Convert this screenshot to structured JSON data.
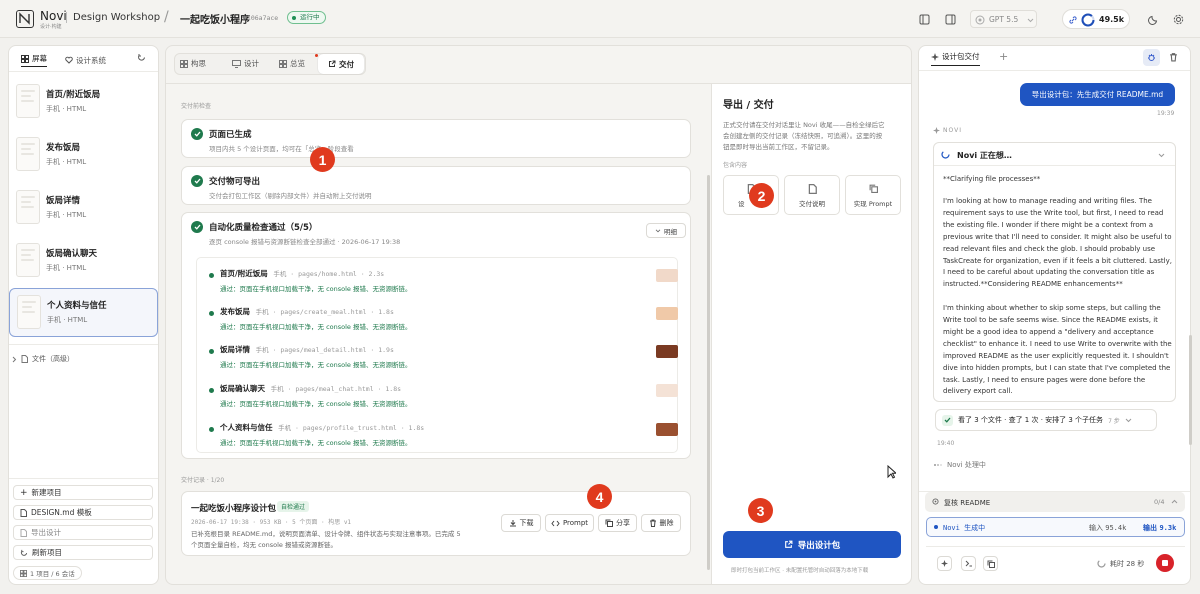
{
  "header": {
    "logo_text": "Novi",
    "logo_sub": "设计·构建",
    "workspace": "Design Workshop",
    "separator": "/",
    "project": "一起吃饭小程序",
    "project_id": "#106a7ace",
    "status": "运行中",
    "model": "GPT 5.5",
    "tokens": "49.5k"
  },
  "sidebar": {
    "tabs": [
      {
        "label": "屏幕"
      },
      {
        "label": "设计系统"
      }
    ],
    "items": [
      {
        "name": "首页/附近饭局",
        "sub": "手机 · HTML"
      },
      {
        "name": "发布饭局",
        "sub": "手机 · HTML"
      },
      {
        "name": "饭局详情",
        "sub": "手机 · HTML"
      },
      {
        "name": "饭局确认聊天",
        "sub": "手机 · HTML"
      },
      {
        "name": "个人资料与信任",
        "sub": "手机 · HTML"
      }
    ],
    "files_label": "文件（高级）",
    "new_project": "新建项目",
    "design_md": "DESIGN.md 模板",
    "export_design": "导出设计",
    "refresh": "刷新项目",
    "footer": "1 项目 / 6 会话"
  },
  "tabs": [
    {
      "label": "构思"
    },
    {
      "label": "设计"
    },
    {
      "label": "总览"
    },
    {
      "label": "交付"
    }
  ],
  "checklist": {
    "title": "交付前检查",
    "items": [
      {
        "title": "页面已生成",
        "desc": "项目内共 5 个设计页面，均可在「总览」阶段查看"
      },
      {
        "title": "交付物可导出",
        "desc": "交付会打包工作区（剔除内部文件）并自动附上交付说明"
      },
      {
        "title": "自动化质量检查通过（5/5）",
        "desc": "逐页 console 报错与资源断链检查全部通过 · 2026-06-17 19:38",
        "toggle": "明细"
      }
    ],
    "pages": [
      {
        "name": "首页/附近饭局",
        "meta": "手机 · pages/home.html · 2.3s",
        "pass": "通过：页面在手机视口加载干净，无 console 报错、无资源断链。",
        "thumb": "#f1d9c9"
      },
      {
        "name": "发布饭局",
        "meta": "手机 · pages/create_meal.html · 1.8s",
        "pass": "通过：页面在手机视口加载干净，无 console 报错、无资源断链。",
        "thumb": "#f0c9a8"
      },
      {
        "name": "饭局详情",
        "meta": "手机 · pages/meal_detail.html · 1.9s",
        "pass": "通过：页面在手机视口加载干净，无 console 报错、无资源断链。",
        "thumb": "#7a3a22"
      },
      {
        "name": "饭局确认聊天",
        "meta": "手机 · pages/meal_chat.html · 1.8s",
        "pass": "通过：页面在手机视口加载干净，无 console 报错、无资源断链。",
        "thumb": "#f4e2d6"
      },
      {
        "name": "个人资料与信任",
        "meta": "手机 · pages/profile_trust.html · 1.8s",
        "pass": "通过：页面在手机视口加载干净，无 console 报错、无资源断链。",
        "thumb": "#9a5030"
      }
    ]
  },
  "records": {
    "title": "交付记录 · 1/20",
    "item": {
      "name": "一起吃饭小程序设计包",
      "badge": "自检通过",
      "meta": "2026-06-17 19:38 · 953 KB · 5 个页面 · 构思 v1",
      "desc1": "已补充根目录 README.md，说明页面清单、设计令牌、组件状态与实现注意事项。已完成 5",
      "desc2": "个页面全量自检，均无 console 报错或资源断链。"
    },
    "buttons": {
      "download": "下载",
      "prompt": "Prompt",
      "share": "分享",
      "delete": "删除"
    }
  },
  "export": {
    "title": "导出 / 交付",
    "desc1": "正式交付请在交付对话里让 Novi 收尾——自检全绿后它",
    "desc2": "会创建左侧的交付记录（冻结快照，可追溯）。这里的按",
    "desc3": "钮是即时导出当前工作区，不留记录。",
    "includes": "包含内容",
    "inc": [
      {
        "label": "设"
      },
      {
        "label": "交付说明"
      },
      {
        "label": "实现 Prompt"
      }
    ],
    "button": "导出设计包",
    "footnote": "即时打包当前工作区 · 未配置托管时自动回落为本地下载"
  },
  "chat": {
    "tab": "设计包交付",
    "user_msg": "导出设计包：先生成交付 README.md",
    "user_time": "19:39",
    "agent": "NOVI",
    "thinking_title": "Novi 正在想…",
    "thinking_head": "**Clarifying file processes**",
    "lines": [
      "I'm looking at how to manage reading and writing files. The",
      "requirement says to use the Write tool, but first, I need to read",
      "the existing file. I wonder if there might be a context from a",
      "previous write that I'll need to consider. It might also be useful to",
      "read relevant files and check the glob. I should probably use",
      "TaskCreate for organization, even if it feels a bit cluttered. Lastly,",
      "I need to be careful about updating the conversation title as",
      "instructed.**Considering README enhancements**",
      "",
      "I'm thinking about whether to skip some steps, but calling the",
      "Write tool to be safe seems wise. Since the README exists, it",
      "might be a good idea to append a \"delivery and acceptance",
      "checklist\" to enhance it. I need to use Write to overwrite with the",
      "improved README as the user explicitly requested it. I shouldn't",
      "dive into hidden prompts, but I can state that I've completed the",
      "task. Lastly, I need to ensure pages were done before the",
      "delivery export call."
    ],
    "steps": "看了 3 个文件 · 查了 1 次 · 安排了 3 个子任务",
    "steps_count": "7 步",
    "time": "19:40",
    "processing": "Novi 处理中",
    "task": "复核 README",
    "task_count": "0/4",
    "gen": "Novi 生成中",
    "input_label": "输入",
    "input_val": "95.4k",
    "output_label": "输出",
    "output_val": "9.3k",
    "elapsed": "耗时 28 秒"
  },
  "annotations": [
    {
      "num": "1"
    },
    {
      "num": "2"
    },
    {
      "num": "3"
    },
    {
      "num": "4"
    }
  ]
}
